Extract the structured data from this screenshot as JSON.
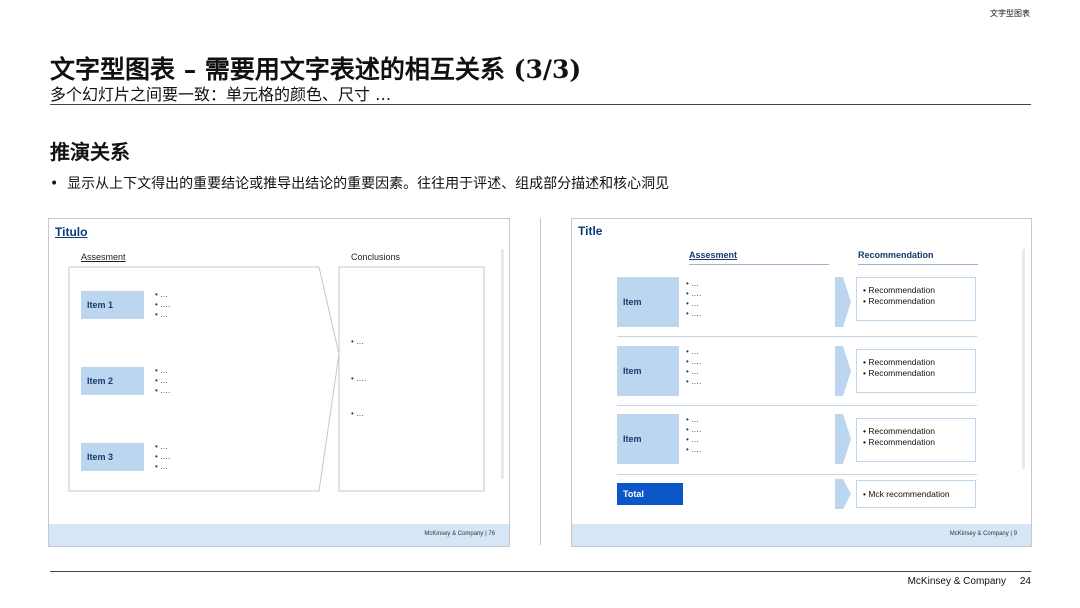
{
  "header_tag": "文字型图表",
  "title": "文字型图表 – 需要用文字表述的相互关系 (3/3)",
  "subtitle": "多个幻灯片之间要一致：单元格的颜色、尺寸 …",
  "section_title": "推演关系",
  "bullet": "显示从上下文得出的重要结论或推导出结论的重要因素。往往用于评述、组成部分描述和核心洞见",
  "slide1": {
    "title": "Titulo",
    "col1_header": "Assesment",
    "col2_header": "Conclusions",
    "items": [
      {
        "label": "Item 1",
        "dots": "• …\n• ….\n• …"
      },
      {
        "label": "Item 2",
        "dots": "• …\n• …\n• …."
      },
      {
        "label": "Item 3",
        "dots": "• …\n• ….\n• …"
      }
    ],
    "conclusions": [
      "• …",
      "• ….",
      "• …"
    ],
    "footer": "McKinsey & Company  |  76"
  },
  "slide2": {
    "title": "Title",
    "col1_header": "Assesment",
    "col2_header": "Recommendation",
    "rows": [
      {
        "label": "Item",
        "dots": "• …\n• ….\n• …\n• ….",
        "recs": "• Recommendation\n• Recommendation"
      },
      {
        "label": "Item",
        "dots": "• …\n• ….\n• …\n• ….",
        "recs": "• Recommendation\n• Recommendation"
      },
      {
        "label": "Item",
        "dots": "• …\n• ….\n• …\n• ….",
        "recs": "• Recommendation\n• Recommendation"
      }
    ],
    "total_label": "Total",
    "total_rec": "• Mck recommendation",
    "footer": "McKinsey & Company  |  9"
  },
  "footer": {
    "company": "McKinsey & Company",
    "page": "24"
  }
}
